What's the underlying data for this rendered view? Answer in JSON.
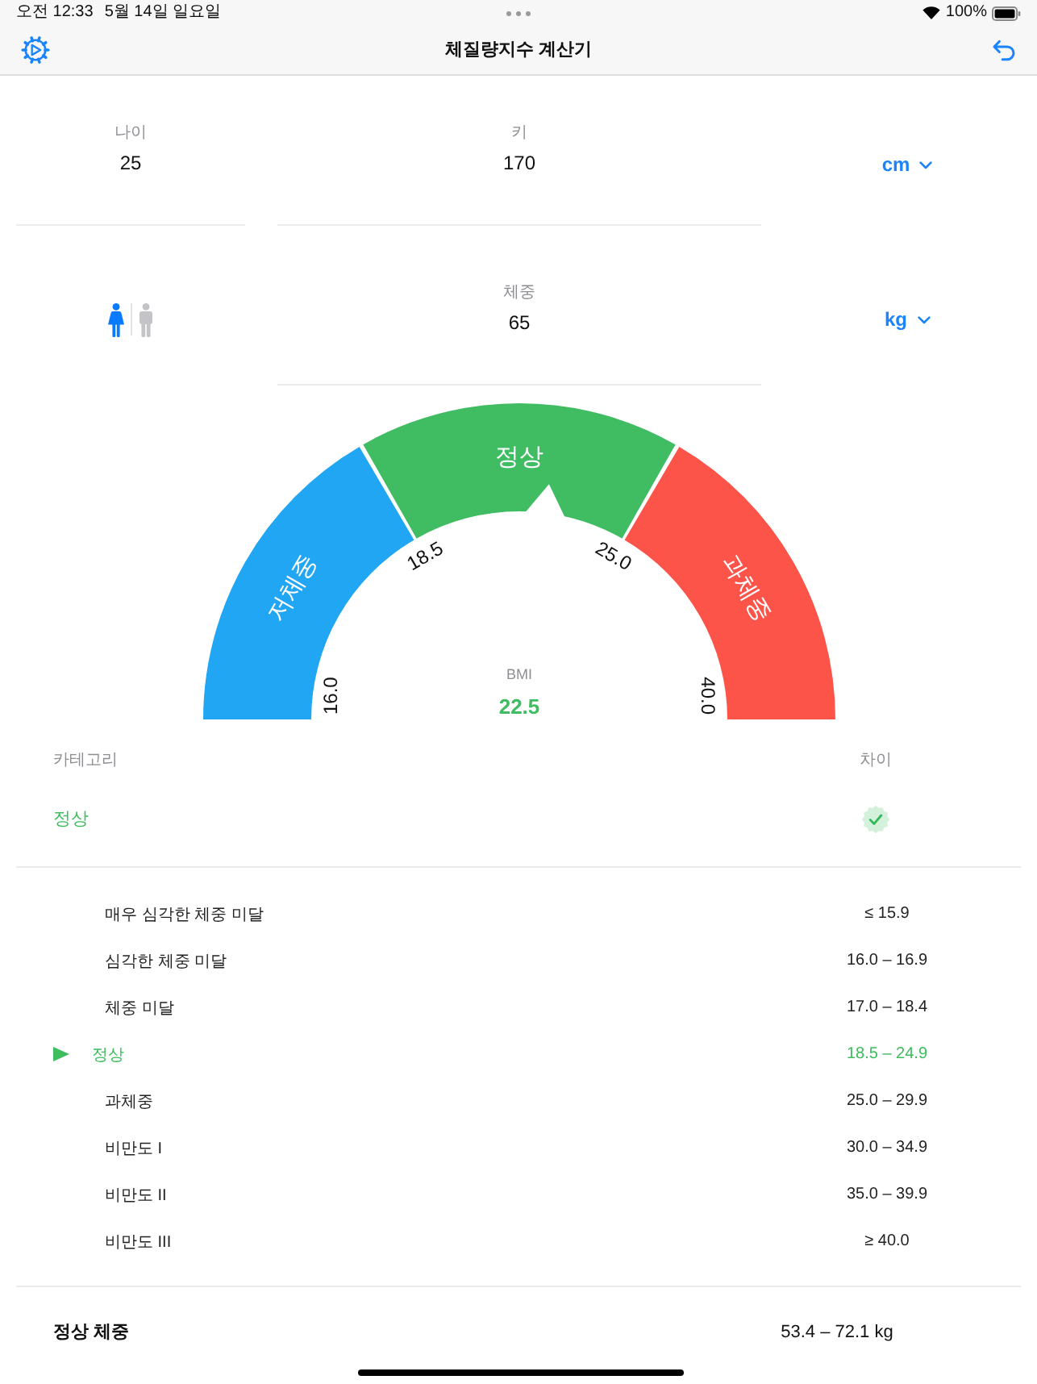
{
  "status_bar": {
    "time": "오전 12:33",
    "date": "5월 14일 일요일",
    "battery": "100%"
  },
  "nav_bar": {
    "title": "체질량지수 계산기"
  },
  "inputs": {
    "age": {
      "label": "나이",
      "value": "25"
    },
    "height": {
      "label": "키",
      "value": "170",
      "unit": "cm"
    },
    "gender_options": [
      {
        "kind": "female",
        "selected": true
      },
      {
        "kind": "male",
        "selected": false
      }
    ],
    "weight": {
      "label": "체중",
      "value": "65",
      "unit": "kg"
    }
  },
  "gauge": {
    "level": 0.54,
    "segments": [
      {
        "label": "저체중",
        "color": "#21a6f3"
      },
      {
        "label": "정상",
        "color": "#40bc63"
      },
      {
        "label": "과체중",
        "color": "#fd5449"
      }
    ],
    "ticks": [
      "16.0",
      "18.5",
      "25.0",
      "40.0"
    ],
    "caption": "BMI",
    "value": "22.5"
  },
  "category": {
    "heading": "카테고리",
    "value": "정상",
    "difference_heading": "차이"
  },
  "ranges": [
    {
      "name": "매우 심각한 체중 미달",
      "range": "≤ 15.9",
      "selected": false
    },
    {
      "name": "심각한 체중 미달",
      "range": "16.0 – 16.9",
      "selected": false
    },
    {
      "name": "체중 미달",
      "range": "17.0 – 18.4",
      "selected": false
    },
    {
      "name": "정상",
      "range": "18.5 – 24.9",
      "selected": true
    },
    {
      "name": "과체중",
      "range": "25.0 – 29.9",
      "selected": false
    },
    {
      "name": "비만도 I",
      "range": "30.0 – 34.9",
      "selected": false
    },
    {
      "name": "비만도 II",
      "range": "35.0 – 39.9",
      "selected": false
    },
    {
      "name": "비만도 III",
      "range": "≥ 40.0",
      "selected": false
    }
  ],
  "normal_weight": {
    "label": "정상 체중",
    "value": "53.4 – 72.1 kg"
  }
}
